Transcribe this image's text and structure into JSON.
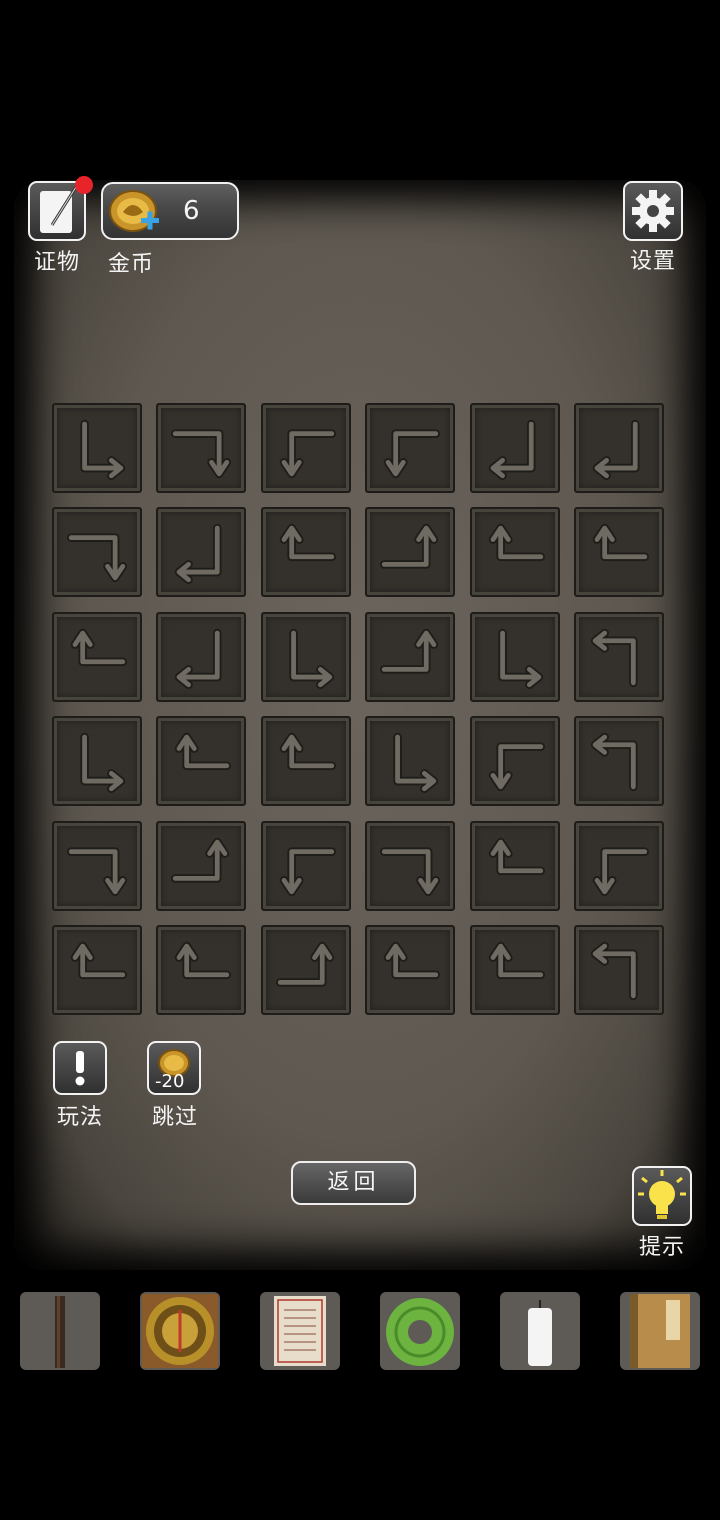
{
  "hud": {
    "evidence_label": "证物",
    "coins_label": "金币",
    "coins_value": "6",
    "settings_label": "设置"
  },
  "puzzle": {
    "grid": [
      [
        "down-right",
        "right-down",
        "left-down",
        "left-down",
        "down-left",
        "down-left"
      ],
      [
        "right-down",
        "down-left",
        "up-right",
        "right-up",
        "up-right",
        "up-right"
      ],
      [
        "up-right",
        "down-left",
        "down-right",
        "right-up",
        "down-right",
        "up-left"
      ],
      [
        "down-right",
        "up-right",
        "up-right",
        "down-right",
        "left-down",
        "up-left"
      ],
      [
        "right-down",
        "right-up",
        "left-down",
        "right-down",
        "up-right",
        "left-down"
      ],
      [
        "up-right",
        "up-right",
        "right-up",
        "up-right",
        "up-right",
        "up-left"
      ]
    ]
  },
  "actions": {
    "how_to_play_label": "玩法",
    "skip_label": "跳过",
    "skip_cost": "-20",
    "back_label": "返回",
    "hint_label": "提示"
  },
  "inventory": [
    "wooden-stick",
    "luopan-compass",
    "paper-document",
    "jade-bi-disc",
    "white-candle",
    "old-book"
  ]
}
